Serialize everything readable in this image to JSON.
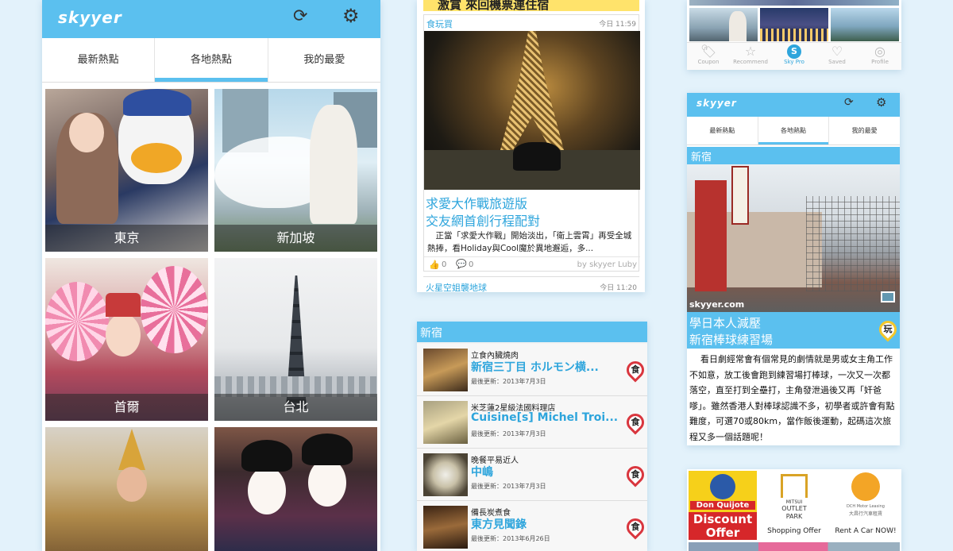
{
  "app": {
    "logo": "skyyer"
  },
  "tabs": [
    "最新熱點",
    "各地熱點",
    "我的最愛"
  ],
  "cities": [
    "東京",
    "新加坡",
    "首爾",
    "台北"
  ],
  "feed": {
    "top_banner": "激賞 來回機票連住宿",
    "card1": {
      "category": "食玩買",
      "time": "今日 11:59",
      "title_line1": "求愛大作戰旅遊版",
      "title_line2": "交友網首創行程配對",
      "excerpt": "　正當「求愛大作戰」開始淡出，「衛上雲霄」再受全城熱捧，看Holiday與Cool魔於異地邂逅，多...",
      "likes": "0",
      "comments": "0",
      "author": "by skyyer Luby"
    },
    "card2": {
      "category": "火星空姐襲地球",
      "time": "今日 11:20"
    }
  },
  "list_panel": {
    "header": "新宿",
    "rows": [
      {
        "subtitle": "立食內臟燒肉",
        "title": "新宿三丁目 ホルモン横...",
        "updated": "最後更新：2013年7月3日",
        "pin": "食"
      },
      {
        "subtitle": "米芝蓮2星級法國料理店",
        "title": "Cuisine[s] Michel Troi...",
        "updated": "最後更新：2013年7月3日",
        "pin": "食"
      },
      {
        "subtitle": "晚餐平易近人",
        "title": "中嶋",
        "updated": "最後更新：2013年7月3日",
        "pin": "食"
      },
      {
        "subtitle": "備長炭煮食",
        "title": "東方見聞錄",
        "updated": "最後更新：2013年6月26日",
        "pin": "食"
      }
    ]
  },
  "bottom_nav": [
    {
      "icon": "coupon-icon",
      "label": "Coupon"
    },
    {
      "icon": "star-icon",
      "label": "Recommend"
    },
    {
      "icon": "skypro-icon",
      "label": "Sky Pro"
    },
    {
      "icon": "heart-icon",
      "label": "Saved"
    },
    {
      "icon": "profile-icon",
      "label": "Profile"
    }
  ],
  "small_phone": {
    "logo": "skyyer",
    "tabs": [
      "最新熱點",
      "各地熱點",
      "我的最愛"
    ],
    "location": "新宿",
    "watermark": "skyyer.com",
    "title_line1": "學日本人減壓",
    "title_line2": "新宿棒球練習場",
    "pin": "玩",
    "body": "看日劇經常會有個常見的劇情就是男或女主角工作不如意，放工後會跑到練習場打棒球，一次又一次都落空，直至打到全壘打，主角發泄過後又再「奸爸嗲」。雖然香港人對棒球認識不多，初學者或許會有點難度，可選70或80km，當作飯後運動，起碼這次旅程又多一個話題呢！"
  },
  "partners": [
    {
      "logo_line1": "Don Quijote",
      "logo_line2": "Discount",
      "logo_line3": "Offer",
      "caption": ""
    },
    {
      "logo_line1": "MITSUI",
      "logo_line2": "OUTLET",
      "logo_line3": "PARK",
      "caption": "Shopping Offer"
    },
    {
      "logo_line1": "DCH Motor Leasing",
      "logo_line2": "大昌行汽車租賃",
      "logo_line3": "",
      "caption": "Rent A Car NOW!"
    }
  ],
  "colors": {
    "accent": "#5bc0ef",
    "title_cyan": "#2ea5dc",
    "pin_red": "#d9363e",
    "background": "#e3f2fb"
  }
}
